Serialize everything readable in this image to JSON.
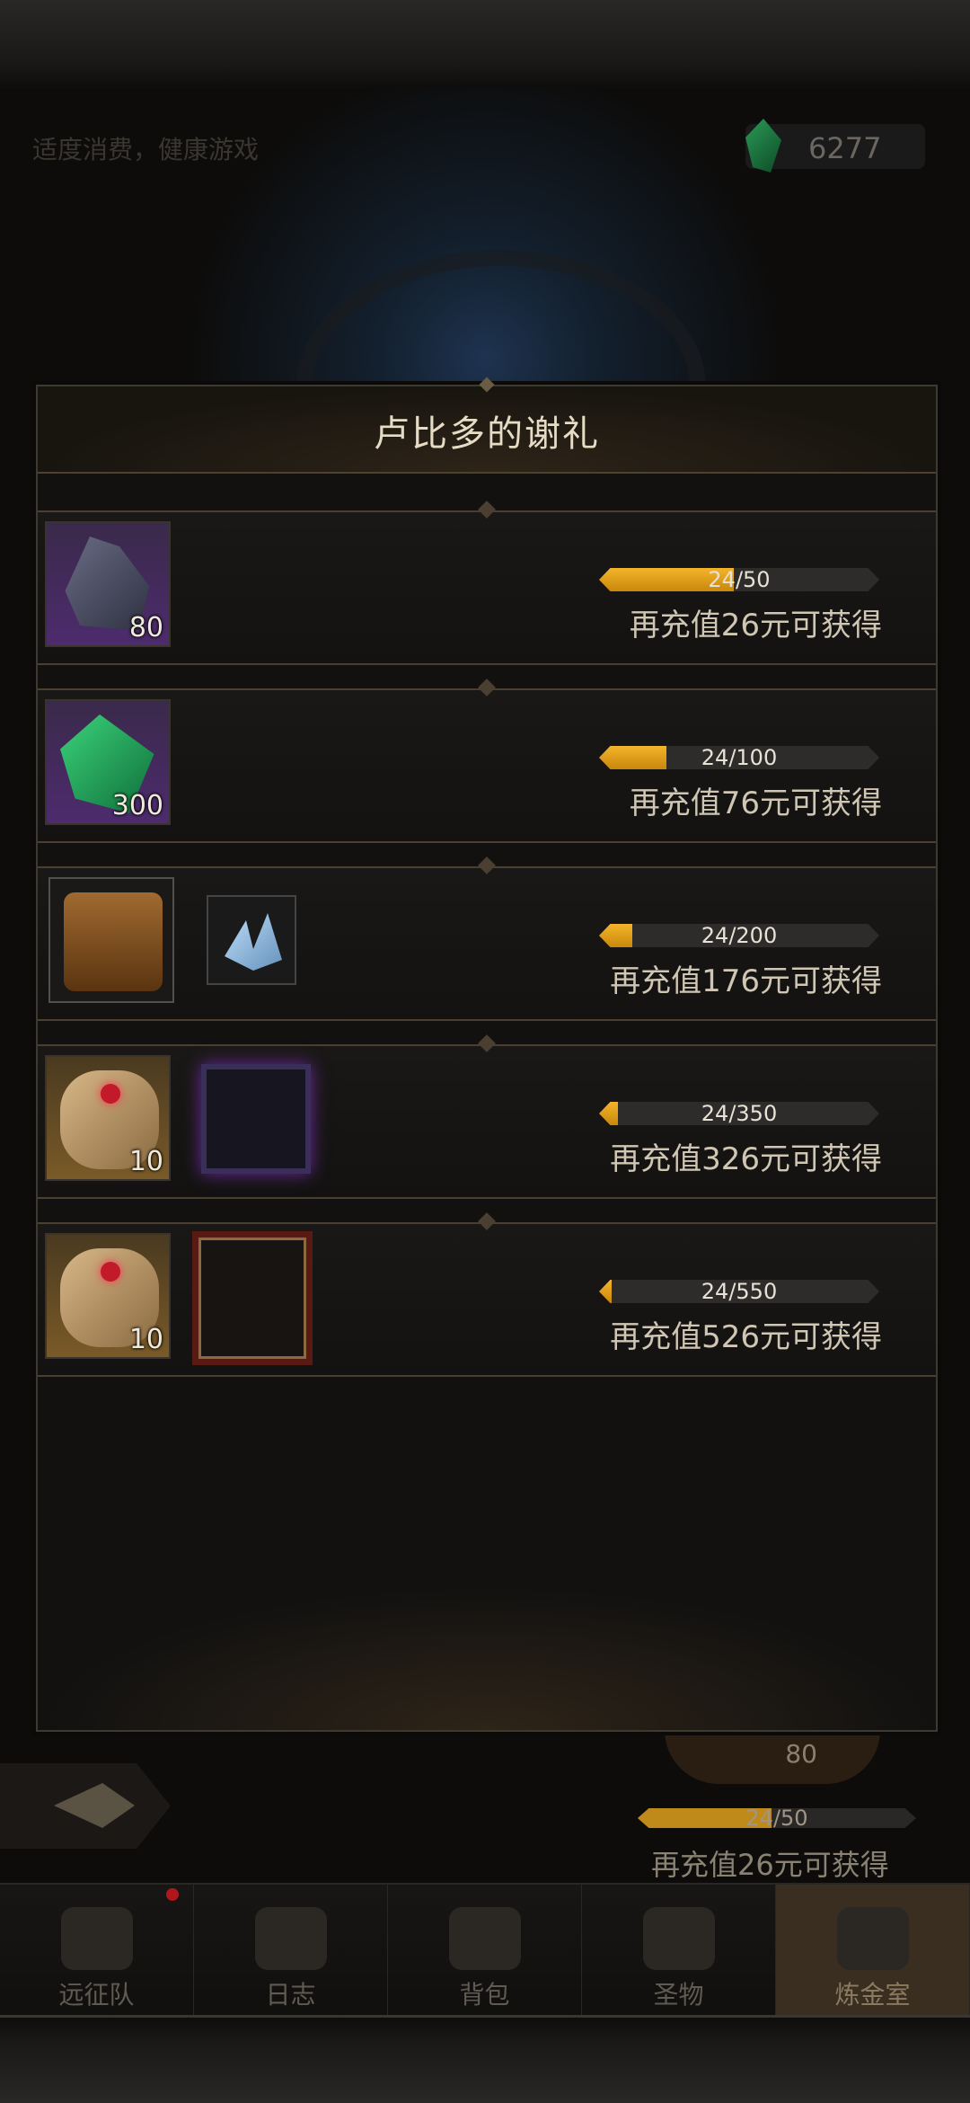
{
  "header": {
    "notice": "适度消费，健康游戏",
    "currency_amount": "6277",
    "currency_icon": "green-gem-icon"
  },
  "modal": {
    "title": "卢比多的谢礼",
    "rows": [
      {
        "items": [
          {
            "icon": "ore-icon",
            "qty": "80"
          }
        ],
        "progress_text": "24/50",
        "progress": 0.48,
        "hint": "再充值26元可获得"
      },
      {
        "items": [
          {
            "icon": "green-gem-icon",
            "qty": "300"
          }
        ],
        "progress_text": "24/100",
        "progress": 0.24,
        "hint": "再充值76元可获得"
      },
      {
        "items": [
          {
            "icon": "treasure-chest-icon",
            "qty": ""
          },
          {
            "icon": "ice-crystal-icon",
            "qty": ""
          }
        ],
        "progress_text": "24/200",
        "progress": 0.12,
        "hint": "再充值176元可获得"
      },
      {
        "items": [
          {
            "icon": "scroll-icon",
            "qty": "10"
          },
          {
            "icon": "purple-frame-icon",
            "qty": ""
          }
        ],
        "progress_text": "24/350",
        "progress": 0.0686,
        "hint": "再充值326元可获得"
      },
      {
        "items": [
          {
            "icon": "scroll-icon",
            "qty": "10"
          },
          {
            "icon": "red-frame-icon",
            "qty": ""
          }
        ],
        "progress_text": "24/550",
        "progress": 0.0436,
        "hint": "再充值526元可获得"
      }
    ]
  },
  "background": {
    "reward_qty": "80",
    "progress_text": "24/50",
    "progress": 0.48,
    "hint": "再充值26元可获得"
  },
  "nav": {
    "items": [
      {
        "label": "远征队",
        "icon": "viking-helmet-icon"
      },
      {
        "label": "日志",
        "icon": "journal-icon"
      },
      {
        "label": "背包",
        "icon": "backpack-icon"
      },
      {
        "label": "圣物",
        "icon": "relic-torch-icon"
      },
      {
        "label": "炼金室",
        "icon": "alchemy-icon"
      }
    ]
  },
  "colors": {
    "accent": "#f4b52a",
    "bar_bg": "#2e2c2a",
    "notification": "#b0161b"
  }
}
